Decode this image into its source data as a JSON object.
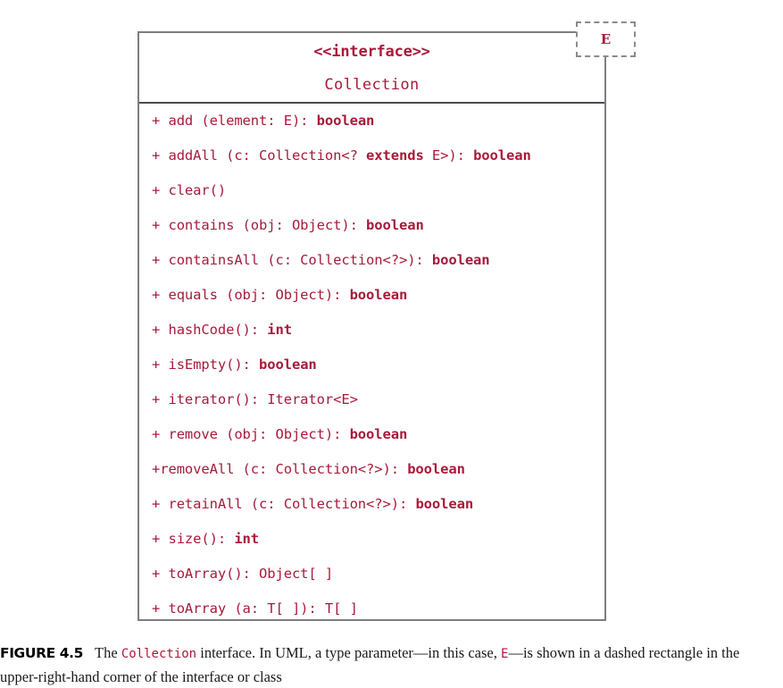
{
  "diagram": {
    "type_parameter": "E",
    "stereotype": "<<interface>>",
    "class_name": "Collection",
    "accent_color": "#a81a3a",
    "border_color": "#7d7d82",
    "members": [
      {
        "visibility": "+",
        "signature": "add (element: E): ",
        "return_type": "boolean",
        "bold_return": true
      },
      {
        "visibility": "+",
        "signature": "addAll (c: Collection<? ",
        "keyword": "extends",
        "signature_tail": " E>): ",
        "return_type": "boolean",
        "bold_return": true
      },
      {
        "visibility": "+",
        "signature": "clear()",
        "return_type": "",
        "bold_return": false
      },
      {
        "visibility": "+",
        "signature": "contains (obj: Object): ",
        "return_type": "boolean",
        "bold_return": true
      },
      {
        "visibility": "+",
        "signature": "containsAll (c: Collection<?>): ",
        "return_type": "boolean",
        "bold_return": true
      },
      {
        "visibility": "+",
        "signature": "equals (obj: Object): ",
        "return_type": "boolean",
        "bold_return": true
      },
      {
        "visibility": "+",
        "signature": "hashCode(): ",
        "return_type": "int",
        "bold_return": true
      },
      {
        "visibility": "+",
        "signature": "isEmpty(): ",
        "return_type": "boolean",
        "bold_return": true
      },
      {
        "visibility": "+",
        "signature": "iterator(): Iterator<E>",
        "return_type": "",
        "bold_return": false
      },
      {
        "visibility": "+",
        "signature": "remove (obj: Object): ",
        "return_type": "boolean",
        "bold_return": true
      },
      {
        "visibility": "+",
        "signature": "removeAll (c: Collection<?>): ",
        "return_type": "boolean",
        "bold_return": true,
        "no_space_after_plus": true
      },
      {
        "visibility": "+",
        "signature": "retainAll (c: Collection<?>): ",
        "return_type": "boolean",
        "bold_return": true
      },
      {
        "visibility": "+",
        "signature": "size(): ",
        "return_type": "int",
        "bold_return": true
      },
      {
        "visibility": "+",
        "signature": "toArray(): Object[ ]",
        "return_type": "",
        "bold_return": false
      },
      {
        "visibility": "+",
        "signature": "toArray (a: T[ ]): T[ ]",
        "return_type": "",
        "bold_return": false
      }
    ],
    "member_lines": [
      "+ add (element: E): boolean",
      "+ addAll (c: Collection<? extends E>): boolean",
      "+ clear()",
      "+ contains (obj: Object): boolean",
      "+ containsAll (c: Collection<?>): boolean",
      "+ equals (obj: Object): boolean",
      "+ hashCode(): int",
      "+ isEmpty(): boolean",
      "+ iterator(): Iterator<E>",
      "+ remove (obj: Object): boolean",
      "+removeAll (c: Collection<?>): boolean",
      "+ retainAll (c: Collection<?>): boolean",
      "+ size(): int",
      "+ toArray(): Object[ ]",
      "+ toArray (a: T[ ]): T[ ]"
    ]
  },
  "caption": {
    "figure_label": "FIGURE 4.5",
    "text_1": "The ",
    "code_1": "Collection",
    "text_2": " interface. In UML, a type parameter—in this case, ",
    "code_2": "E",
    "text_3": "—is shown in a dashed rectangle in the upper-right-hand corner of the interface or class"
  }
}
